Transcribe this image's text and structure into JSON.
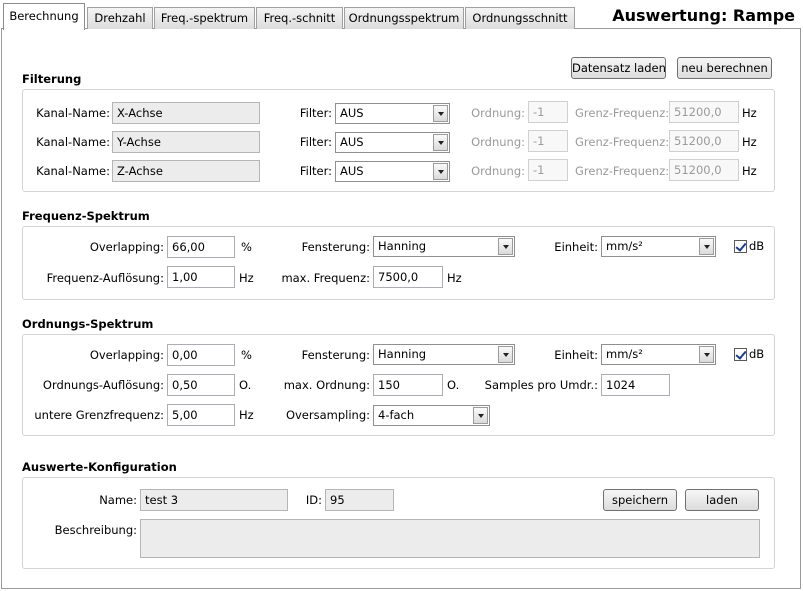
{
  "tabs": [
    "Berechnung",
    "Drehzahl",
    "Freq.-spektrum",
    "Freq.-schnitt",
    "Ordnungsspektrum",
    "Ordnungsschnitt"
  ],
  "page_title": "Auswertung: Rampe",
  "toolbar": {
    "load_dataset": "Datensatz laden",
    "recalculate": "neu berechnen"
  },
  "filterung": {
    "title": "Filterung",
    "rows": [
      {
        "channel_label": "Kanal-Name:",
        "channel": "X-Achse",
        "filter_label": "Filter:",
        "filter": "AUS",
        "order_label": "Ordnung:",
        "order": "-1",
        "limit_label": "Grenz-Frequenz:",
        "limit": "51200,0",
        "unit": "Hz"
      },
      {
        "channel_label": "Kanal-Name:",
        "channel": "Y-Achse",
        "filter_label": "Filter:",
        "filter": "AUS",
        "order_label": "Ordnung:",
        "order": "-1",
        "limit_label": "Grenz-Frequenz:",
        "limit": "51200,0",
        "unit": "Hz"
      },
      {
        "channel_label": "Kanal-Name:",
        "channel": "Z-Achse",
        "filter_label": "Filter:",
        "filter": "AUS",
        "order_label": "Ordnung:",
        "order": "-1",
        "limit_label": "Grenz-Frequenz:",
        "limit": "51200,0",
        "unit": "Hz"
      }
    ]
  },
  "freq_spectrum": {
    "title": "Frequenz-Spektrum",
    "overlap_label": "Overlapping:",
    "overlap": "66,00",
    "overlap_unit": "%",
    "window_label": "Fensterung:",
    "window": "Hanning",
    "unit_label": "Einheit:",
    "unit": "mm/s²",
    "db_label": "dB",
    "db_checked": true,
    "resolution_label": "Frequenz-Auflösung:",
    "resolution": "1,00",
    "resolution_unit": "Hz",
    "maxfreq_label": "max. Frequenz:",
    "maxfreq": "7500,0",
    "maxfreq_unit": "Hz"
  },
  "order_spectrum": {
    "title": "Ordnungs-Spektrum",
    "overlap_label": "Overlapping:",
    "overlap": "0,00",
    "overlap_unit": "%",
    "window_label": "Fensterung:",
    "window": "Hanning",
    "unit_label": "Einheit:",
    "unit": "mm/s²",
    "db_label": "dB",
    "db_checked": true,
    "resolution_label": "Ordnungs-Auflösung:",
    "resolution": "0,50",
    "resolution_unit": "O.",
    "maxorder_label": "max. Ordnung:",
    "maxorder": "150",
    "maxorder_unit": "O.",
    "samples_label": "Samples pro Umdr.:",
    "samples": "1024",
    "lower_label": "untere Grenzfrequenz:",
    "lower": "5,00",
    "lower_unit": "Hz",
    "oversampling_label": "Oversampling:",
    "oversampling": "4-fach"
  },
  "config": {
    "title": "Auswerte-Konfiguration",
    "name_label": "Name:",
    "name": "test 3",
    "id_label": "ID:",
    "id": "95",
    "save": "speichern",
    "load": "laden",
    "desc_label": "Beschreibung:",
    "desc": ""
  }
}
